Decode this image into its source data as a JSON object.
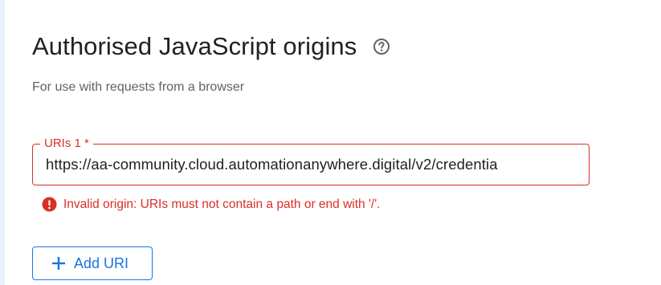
{
  "section": {
    "title": "Authorised JavaScript origins",
    "subtitle": "For use with requests from a browser",
    "help_icon": "help-circle-icon"
  },
  "uri_field": {
    "label": "URIs 1 *",
    "value": "https://aa-community.cloud.automationanywhere.digital/v2/credentia",
    "error_icon": "error-icon",
    "error": "Invalid origin: URIs must not contain a path or end with '/'."
  },
  "add_button": {
    "icon": "plus-icon",
    "label": "Add URI"
  },
  "colors": {
    "error": "#d93025",
    "accent": "#1a73e8",
    "text": "#202124",
    "muted": "#5f6368"
  }
}
